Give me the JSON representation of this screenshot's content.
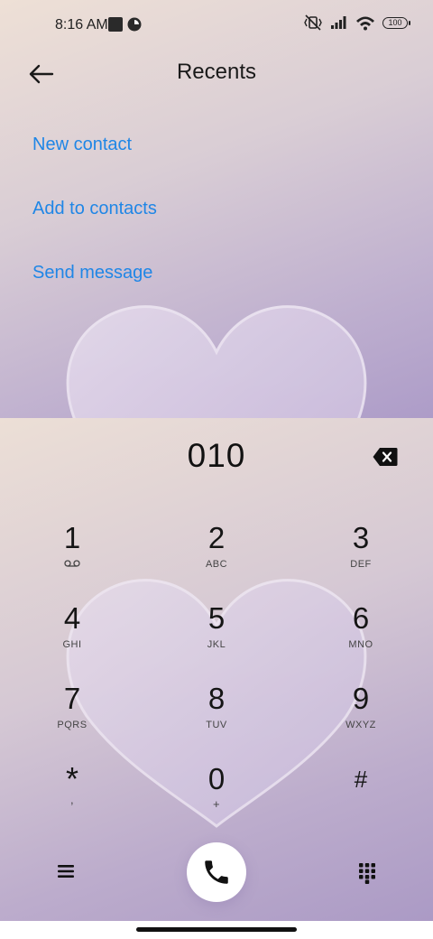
{
  "status_bar": {
    "time": "8:16 AM",
    "battery": "100",
    "icons": [
      "notification-square-icon",
      "app-circle-icon",
      "vibrate-icon",
      "signal-icon",
      "wifi-icon",
      "battery-icon"
    ]
  },
  "header": {
    "title": "Recents",
    "back_icon": "arrow-left-icon"
  },
  "actions": [
    "New contact",
    "Add to contacts",
    "Send message"
  ],
  "dialer": {
    "number": "010",
    "keys": [
      {
        "digit": "1",
        "letters": ""
      },
      {
        "digit": "2",
        "letters": "ABC"
      },
      {
        "digit": "3",
        "letters": "DEF"
      },
      {
        "digit": "4",
        "letters": "GHI"
      },
      {
        "digit": "5",
        "letters": "JKL"
      },
      {
        "digit": "6",
        "letters": "MNO"
      },
      {
        "digit": "7",
        "letters": "PQRS"
      },
      {
        "digit": "8",
        "letters": "TUV"
      },
      {
        "digit": "9",
        "letters": "WXYZ"
      },
      {
        "digit": "*",
        "letters": ","
      },
      {
        "digit": "0",
        "letters": "+"
      },
      {
        "digit": "#",
        "letters": ""
      }
    ]
  },
  "colors": {
    "accent": "#1f86e6",
    "background_top": "#eee0d6",
    "background_bottom": "#ad9cc8"
  }
}
